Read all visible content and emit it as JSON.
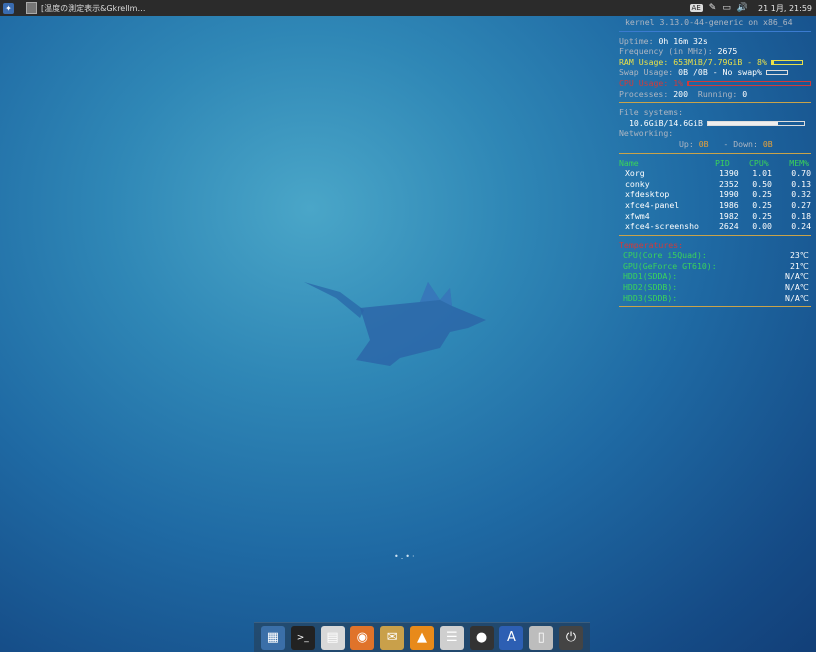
{
  "taskbar": {
    "window_title": "[温度の測定表示&Gkrellm…",
    "clock": "21 1月, 21:59",
    "keyboard_layout": "AE"
  },
  "conky": {
    "kernel": "kernel 3.13.0-44-generic on x86_64",
    "uptime_label": "Uptime:",
    "uptime": "0h 16m 32s",
    "freq_label": "Frequency (in MHz):",
    "freq": "2675",
    "ram_label": "RAM Usage:",
    "ram": "653MiB/7.79GiB - 8%",
    "ram_pct": 0.08,
    "swap_label": "Swap Usage:",
    "swap": "0B  /0B",
    "swap_note": "- No swap%",
    "cpu_label": "CPU Usage:",
    "cpu": "1%",
    "cpu_pct": 0.01,
    "processes_label": "Processes:",
    "processes": "200",
    "running_label": "Running:",
    "running": "0",
    "fs_label": "File systems:",
    "fs": "10.6GiB/14.6GiB",
    "fs_pct": 0.73,
    "net_label": "Networking:",
    "up_label": "Up:",
    "up": "0B",
    "down_label": "- Down:",
    "down": "0B",
    "proc_headers": [
      "Name",
      "PID",
      "CPU%",
      "MEM%"
    ],
    "processes_list": [
      {
        "name": "Xorg",
        "pid": "1390",
        "cpu": "1.01",
        "mem": "0.70"
      },
      {
        "name": "conky",
        "pid": "2352",
        "cpu": "0.50",
        "mem": "0.13"
      },
      {
        "name": "xfdesktop",
        "pid": "1990",
        "cpu": "0.25",
        "mem": "0.32"
      },
      {
        "name": "xfce4-panel",
        "pid": "1986",
        "cpu": "0.25",
        "mem": "0.27"
      },
      {
        "name": "xfwm4",
        "pid": "1982",
        "cpu": "0.25",
        "mem": "0.18"
      },
      {
        "name": "xfce4-screensho",
        "pid": "2624",
        "cpu": "0.00",
        "mem": "0.24"
      }
    ],
    "temp_title": "Temperatures:",
    "temps": [
      {
        "label": "CPU(Core i5Quad):",
        "value": "23℃"
      },
      {
        "label": "GPU(GeForce GT610):",
        "value": "21℃"
      },
      {
        "label": "HDD1(SDDA):",
        "value": "N/A℃"
      },
      {
        "label": "HDD2(SDDB):",
        "value": "N/A℃"
      },
      {
        "label": "HDD3(SDDB):",
        "value": "N/A℃"
      }
    ]
  },
  "dock": [
    {
      "name": "show-desktop-icon",
      "glyph": "▦",
      "bg": "#3b6fa8"
    },
    {
      "name": "terminal-icon",
      "glyph": ">_",
      "bg": "#222222"
    },
    {
      "name": "file-manager-icon",
      "glyph": "▤",
      "bg": "#d8d8d8"
    },
    {
      "name": "firefox-icon",
      "glyph": "◉",
      "bg": "#e0732a"
    },
    {
      "name": "mail-icon",
      "glyph": "✉",
      "bg": "#c9a04a"
    },
    {
      "name": "vlc-icon",
      "glyph": "▲",
      "bg": "#e88a1a"
    },
    {
      "name": "mixer-icon",
      "glyph": "☰",
      "bg": "#cfcfcf"
    },
    {
      "name": "media-player-icon",
      "glyph": "●",
      "bg": "#333333"
    },
    {
      "name": "font-viewer-icon",
      "glyph": "A",
      "bg": "#2d5fb3"
    },
    {
      "name": "trash-icon",
      "glyph": "▯",
      "bg": "#bdbdbd"
    },
    {
      "name": "logout-icon",
      "glyph": "⏻",
      "bg": "#444444"
    }
  ]
}
